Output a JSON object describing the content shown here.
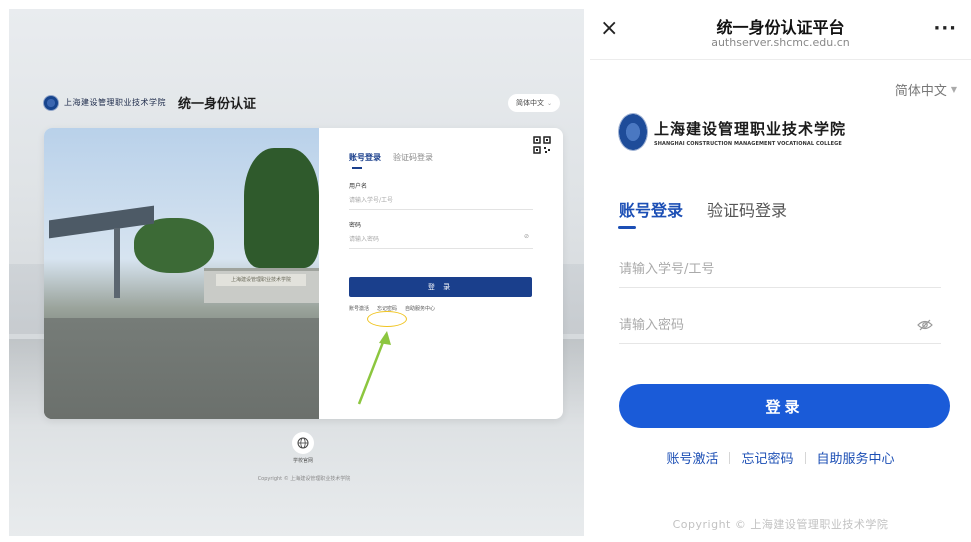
{
  "desktop": {
    "logo_text": "上海建设管理职业技术学院",
    "title": "统一身份认证",
    "lang": "简体中文",
    "photo_sign": "上海建设管理职业技术学院",
    "tabs": {
      "account": "账号登录",
      "code": "验证码登录"
    },
    "username_label": "用户名",
    "username_placeholder": "请输入学号/工号",
    "password_label": "密码",
    "password_placeholder": "请输入密码",
    "login_button": "登 录",
    "links": [
      "账号激活",
      "忘记密码",
      "自助服务中心"
    ],
    "footer_label": "学校官网",
    "footer_copy": "Copyright © 上海建设管理职业技术学院"
  },
  "mobile": {
    "title": "统一身份认证平台",
    "url": "authserver.shcmc.edu.cn",
    "close_icon": "×",
    "more_icon": "···",
    "lang": "简体中文",
    "lang_caret": "▼",
    "logo_cn": "上海建设管理职业技术学院",
    "logo_en": "SHANGHAI CONSTRUCTION MANAGEMENT VOCATIONAL COLLEGE",
    "tabs": {
      "account": "账号登录",
      "code": "验证码登录"
    },
    "username_placeholder": "请输入学号/工号",
    "password_placeholder": "请输入密码",
    "login_button": "登录",
    "links": {
      "activate": "账号激活",
      "forgot": "忘记密码",
      "self_service": "自助服务中心"
    },
    "copyright": "Copyright © 上海建设管理职业技术学院"
  },
  "colors": {
    "mobile_primary": "#1a5bd8",
    "desktop_primary": "#1a3f8c",
    "highlight_circle": "#f0c420",
    "arrow": "#8cc63f"
  }
}
